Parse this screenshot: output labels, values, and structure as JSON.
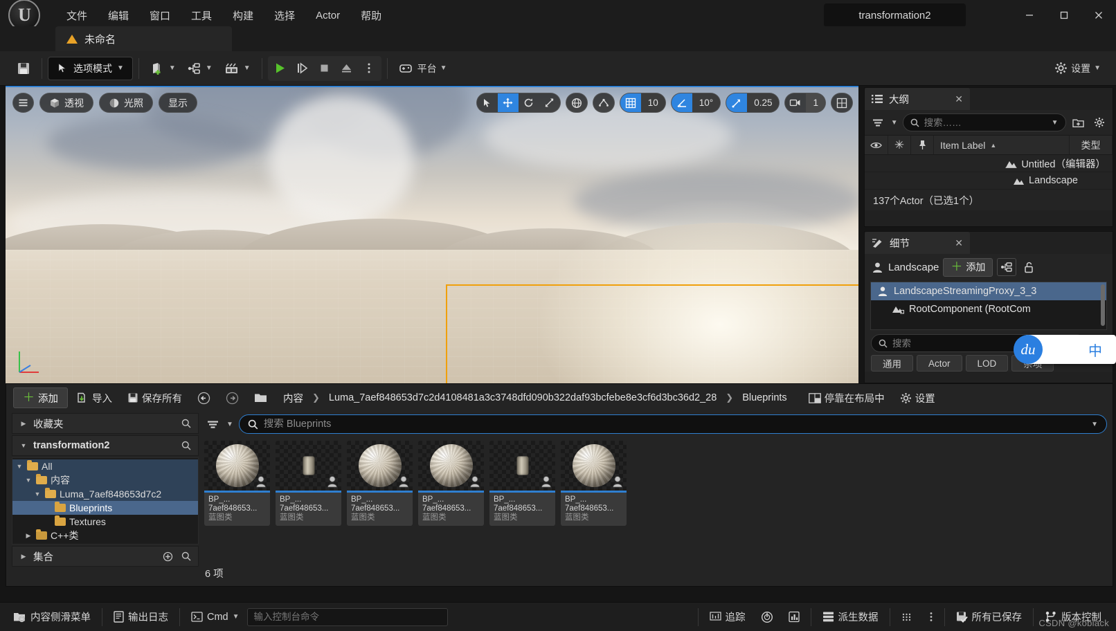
{
  "window": {
    "title": "transformation2",
    "minimize": "—",
    "maximize": "□",
    "close": "✕"
  },
  "menubar": {
    "items": [
      {
        "label": "文件"
      },
      {
        "label": "编辑"
      },
      {
        "label": "窗口"
      },
      {
        "label": "工具"
      },
      {
        "label": "构建"
      },
      {
        "label": "选择"
      },
      {
        "label": "Actor"
      },
      {
        "label": "帮助"
      }
    ]
  },
  "project_tab": {
    "label": "未命名"
  },
  "toolbar": {
    "save_tooltip": "保存",
    "mode_label": "选项模式",
    "platform_label": "平台",
    "settings_label": "设置"
  },
  "viewport": {
    "menu_icon": "hamburger-icon",
    "perspective_label": "透视",
    "lighting_label": "光照",
    "show_label": "显示",
    "grid_snap_value": "10",
    "angle_snap_value": "10°",
    "scale_snap_value": "0.25",
    "camera_speed_value": "1",
    "gizmo_mode": "translate"
  },
  "outliner": {
    "tab_title": "大纲",
    "search_placeholder": "搜索……",
    "columns": [
      "Item Label",
      "类型"
    ],
    "rows": [
      {
        "label": "Untitled（编辑器）",
        "icon": "landscape-icon",
        "indent": 0
      },
      {
        "label": "Landscape",
        "icon": "landscape-icon",
        "indent": 1
      }
    ],
    "footer": "137个Actor（已选1个）"
  },
  "details": {
    "tab_title": "细节",
    "actor_name": "Landscape",
    "add_label": "添加",
    "search_placeholder": "搜索",
    "components": [
      {
        "label": "LandscapeStreamingProxy_3_3",
        "selected": true
      },
      {
        "label": "RootComponent (RootCom",
        "selected": false
      }
    ],
    "filter_tabs": [
      "通用",
      "Actor",
      "LOD",
      "杂项"
    ]
  },
  "ime": {
    "logo_text": "du",
    "mode_text": "中"
  },
  "content_browser": {
    "add_label": "添加",
    "import_label": "导入",
    "save_all_label": "保存所有",
    "breadcrumbs": [
      "内容",
      "Luma_7aef848653d7c2d4108481a3c3748dfd090b322daf93bcfebe8e3cf6d3bc36d2_28",
      "Blueprints"
    ],
    "dock_label": "停靠在布局中",
    "settings_label": "设置",
    "search_placeholder": "搜索 Blueprints",
    "tree": {
      "favorites_label": "收藏夹",
      "project_label": "transformation2",
      "collections_label": "集合",
      "nodes": [
        {
          "label": "All",
          "indent": 0,
          "expanded": true,
          "selected": false,
          "type": "folder"
        },
        {
          "label": "内容",
          "indent": 1,
          "expanded": true,
          "selected": false,
          "type": "folder"
        },
        {
          "label": "Luma_7aef848653d7c2",
          "indent": 2,
          "expanded": true,
          "selected": false,
          "type": "folder"
        },
        {
          "label": "Blueprints",
          "indent": 3,
          "expanded": null,
          "selected": true,
          "type": "folder"
        },
        {
          "label": "Textures",
          "indent": 3,
          "expanded": null,
          "selected": false,
          "type": "folder"
        },
        {
          "label": "C++类",
          "indent": 1,
          "expanded": false,
          "selected": false,
          "type": "cpp"
        }
      ]
    },
    "assets": [
      {
        "name_line1": "BP_...",
        "name_line2": "7aef848653...",
        "type": "蓝图类",
        "thumb": "sphere"
      },
      {
        "name_line1": "BP_...",
        "name_line2": "7aef848653...",
        "type": "蓝图类",
        "thumb": "cylinder"
      },
      {
        "name_line1": "BP_...",
        "name_line2": "7aef848653...",
        "type": "蓝图类",
        "thumb": "sphere"
      },
      {
        "name_line1": "BP_...",
        "name_line2": "7aef848653...",
        "type": "蓝图类",
        "thumb": "sphere"
      },
      {
        "name_line1": "BP_...",
        "name_line2": "7aef848653...",
        "type": "蓝图类",
        "thumb": "cylinder"
      },
      {
        "name_line1": "BP_...",
        "name_line2": "7aef848653...",
        "type": "蓝图类",
        "thumb": "sphere"
      }
    ],
    "item_count": "6 项"
  },
  "statusbar": {
    "content_drawer_label": "内容侧滑菜单",
    "output_log_label": "输出日志",
    "cmd_label": "Cmd",
    "cmd_placeholder": "输入控制台命令",
    "trace_label": "追踪",
    "derived_data_label": "派生数据",
    "all_saved_label": "所有已保存",
    "source_control_label": "版本控制",
    "watermark": "CSDN @koblack"
  },
  "colors": {
    "accent_blue": "#2f7fd0",
    "selection_orange": "#f0a00c",
    "add_green": "#6abf3a",
    "folder_yellow": "#d9a441"
  }
}
